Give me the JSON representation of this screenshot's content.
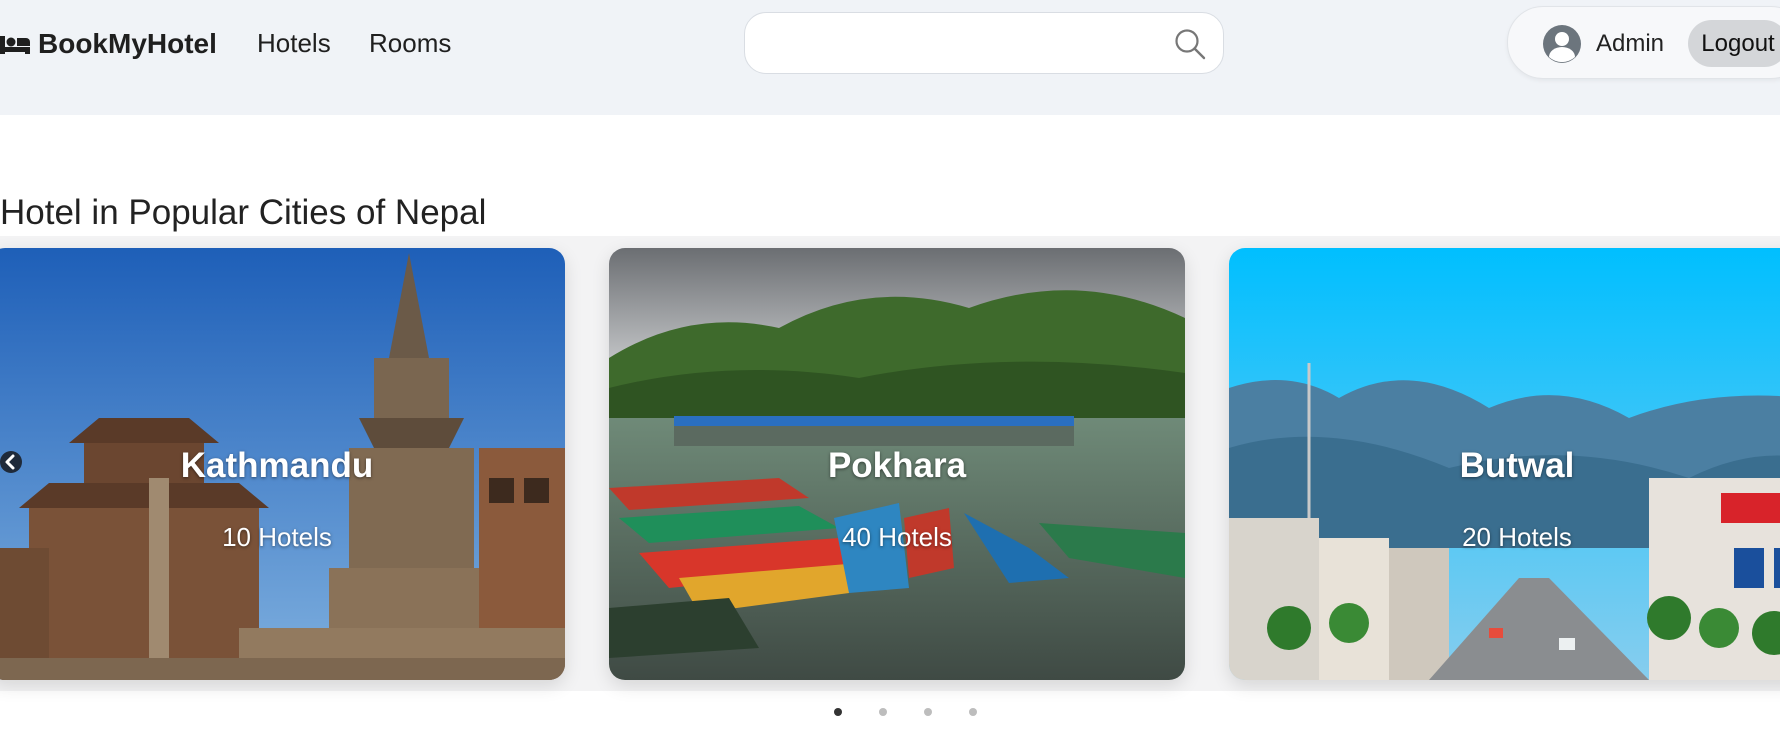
{
  "brand": {
    "name": "BookMyHotel",
    "icon": "bed-icon"
  },
  "nav": {
    "hotels": "Hotels",
    "rooms": "Rooms"
  },
  "search": {
    "placeholder": "",
    "value": "",
    "icon": "search-icon"
  },
  "user": {
    "name": "Admin",
    "logout": "Logout",
    "avatar_icon": "user-avatar-icon"
  },
  "section": {
    "title": "Hotel in Popular Cities of Nepal"
  },
  "cities": [
    {
      "name": "Kathmandu",
      "count": "10 Hotels"
    },
    {
      "name": "Pokhara",
      "count": "40 Hotels"
    },
    {
      "name": "Butwal",
      "count": "20 Hotels"
    }
  ],
  "carousel": {
    "slides": 4,
    "active": 1,
    "prev_icon": "chevron-left-icon"
  },
  "colors": {
    "header_bg": "#f0f3f7",
    "band_bg": "#f3f3f4",
    "dot_active": "#333333",
    "dot_inactive": "#bdbdbd"
  }
}
